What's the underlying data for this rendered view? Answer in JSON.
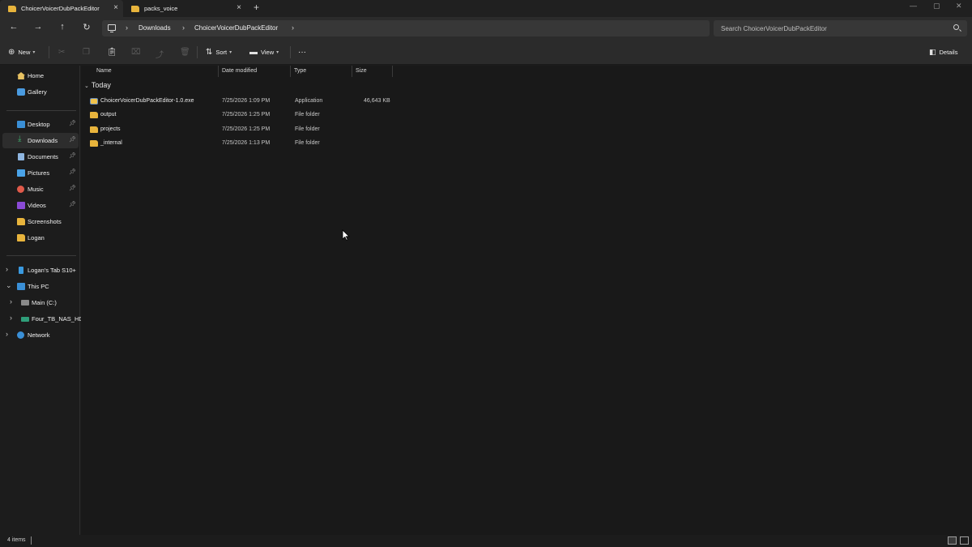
{
  "tabs": [
    {
      "label": "ChoicerVoicerDubPackEditor",
      "active": true
    },
    {
      "label": "packs_voice",
      "active": false
    }
  ],
  "address": {
    "crumbs": [
      "Downloads",
      "ChoicerVoicerDubPackEditor"
    ],
    "search_placeholder": "Search ChoicerVoicerDubPackEditor"
  },
  "toolbar": {
    "new_label": "New",
    "sort_label": "Sort",
    "view_label": "View",
    "more_label": "···",
    "details_label": "Details"
  },
  "sidebar": {
    "quick": [
      {
        "label": "Home",
        "icon": "home-icon"
      },
      {
        "label": "Gallery",
        "icon": "gallery-icon"
      }
    ],
    "pinned": [
      {
        "label": "Desktop",
        "icon": "desktop-icon",
        "pinned": true
      },
      {
        "label": "Downloads",
        "icon": "downloads-icon",
        "pinned": true,
        "selected": true
      },
      {
        "label": "Documents",
        "icon": "documents-icon",
        "pinned": true
      },
      {
        "label": "Pictures",
        "icon": "pictures-icon",
        "pinned": true
      },
      {
        "label": "Music",
        "icon": "music-icon",
        "pinned": true
      },
      {
        "label": "Videos",
        "icon": "videos-icon",
        "pinned": true
      },
      {
        "label": "Screenshots",
        "icon": "folder-icon"
      },
      {
        "label": "Logan",
        "icon": "folder-icon"
      }
    ],
    "devices": [
      {
        "label": "Logan's Tab S10+",
        "icon": "tablet-icon",
        "expander": "›"
      },
      {
        "label": "This PC",
        "icon": "pc-icon",
        "expander": "⌄"
      },
      {
        "label": "Main (C:)",
        "icon": "drive-icon",
        "expander": "›"
      },
      {
        "label": "Four_TB_NAS_HD",
        "icon": "nas-icon",
        "expander": "›"
      },
      {
        "label": "Network",
        "icon": "network-icon",
        "expander": "›"
      }
    ]
  },
  "columns": [
    "Name",
    "Date modified",
    "Type",
    "Size"
  ],
  "group": {
    "label": "Today"
  },
  "files": [
    {
      "name": "ChoicerVoicerDubPackEditor-1.0.exe",
      "date": "7/25/2026 1:09 PM",
      "type": "Application",
      "size": "46,643 KB",
      "icon": "exe-icon"
    },
    {
      "name": "output",
      "date": "7/25/2026 1:25 PM",
      "type": "File folder",
      "size": "",
      "icon": "folder-icon"
    },
    {
      "name": "projects",
      "date": "7/25/2026 1:25 PM",
      "type": "File folder",
      "size": "",
      "icon": "folder-icon"
    },
    {
      "name": "_internal",
      "date": "7/25/2026 1:13 PM",
      "type": "File folder",
      "size": "",
      "icon": "folder-icon"
    }
  ],
  "status": {
    "item_count": "4 items"
  },
  "colors": {
    "accent": "#e8b43c",
    "background": "#191919",
    "chrome": "#2b2b2b"
  }
}
